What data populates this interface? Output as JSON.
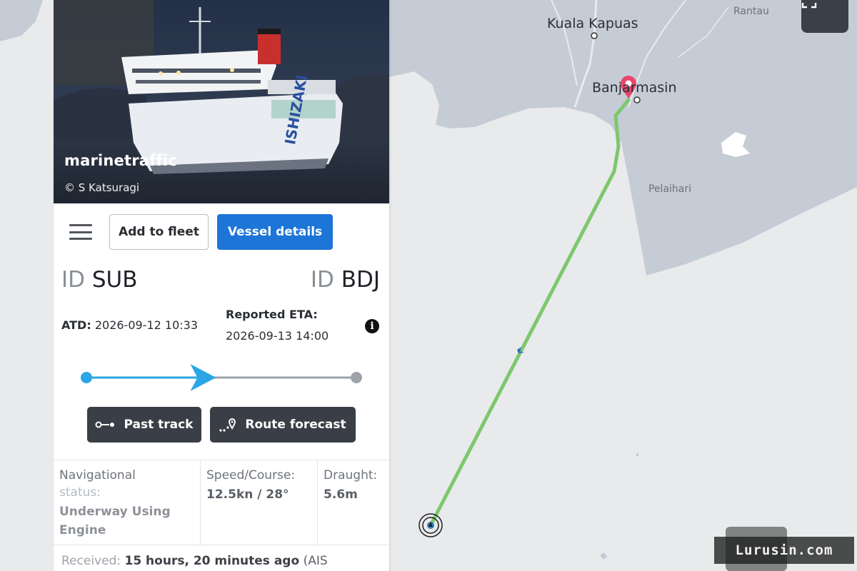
{
  "panel": {
    "photo": {
      "brand": "marinetraffic",
      "credit": "© S Katsuragi",
      "hull_text": "ISHIZAKI"
    },
    "toolbar": {
      "menu_icon": "hamburger-menu-icon",
      "add_to_fleet_label": "Add to fleet",
      "vessel_details_label": "Vessel details"
    },
    "voyage": {
      "from_prefix": "ID",
      "from_code": "SUB",
      "to_prefix": "ID",
      "to_code": "BDJ",
      "atd_label": "ATD:",
      "atd_value": "2026-09-12 10:33",
      "eta_label": "Reported ETA:",
      "eta_value": "2026-09-13 14:00",
      "info_icon": "info-icon",
      "progress_fraction": 0.48
    },
    "actions": {
      "past_track_label": "Past track",
      "past_track_icon": "track-icon",
      "route_forecast_label": "Route forecast",
      "route_forecast_icon": "map-pin-dots-icon"
    },
    "stats": {
      "nav_status_label_1": "Navigational",
      "nav_status_label_2": "status:",
      "nav_status_value_1": "Underway Using",
      "nav_status_value_2": "Engine",
      "speed_label": "Speed/Course:",
      "speed_value": "12.5kn / 28°",
      "draught_label": "Draught:",
      "draught_value": "5.6m"
    },
    "received": {
      "label": "Received:",
      "value": "15 hours, 20 minutes ago",
      "suffix": "(AIS"
    }
  },
  "map": {
    "places": {
      "kuala_kapuas": "Kuala Kapuas",
      "banjarmasin": "Banjarmasin",
      "rantau": "Rantau",
      "pelaihari": "Pelaihari"
    },
    "fullscreen_icon": "fullscreen-icon",
    "destination_icon": "map-pin-icon",
    "vessel_icon": "vessel-position-icon",
    "track_color": "#7dc86d",
    "land_color": "#c5ccd6",
    "sea_color": "#e9eaec",
    "pin_color": "#e8456b"
  },
  "watermark": "Lurusin.com"
}
